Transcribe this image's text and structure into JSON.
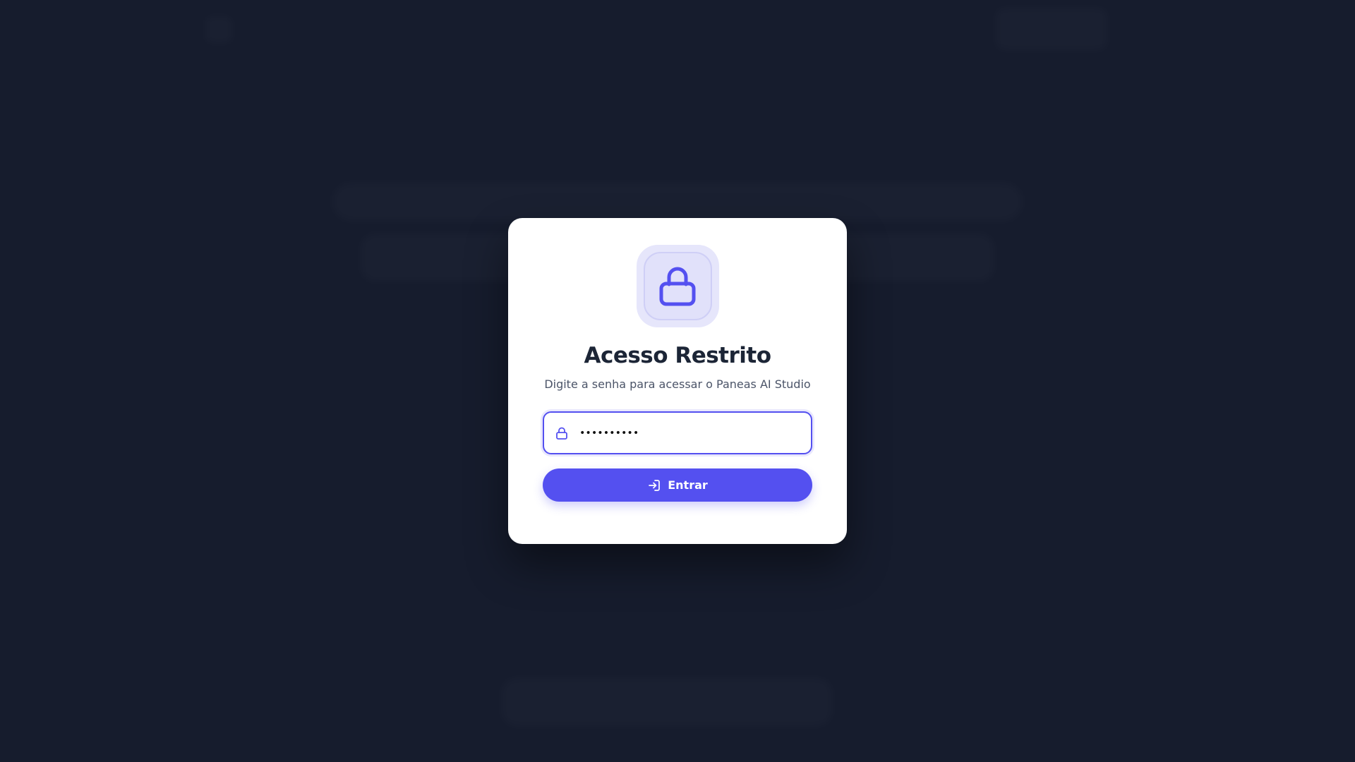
{
  "login": {
    "title": "Acesso Restrito",
    "subtitle": "Digite a senha para acessar o Paneas AI Studio",
    "password_value": "••••••••••",
    "submit_label": "Entrar"
  },
  "icons": {
    "badge": "lock-icon",
    "input": "lock-icon",
    "submit": "login-icon"
  },
  "colors": {
    "background": "#161c2d",
    "accent": "#5450f0",
    "card": "#ffffff",
    "title": "#1c2536"
  }
}
